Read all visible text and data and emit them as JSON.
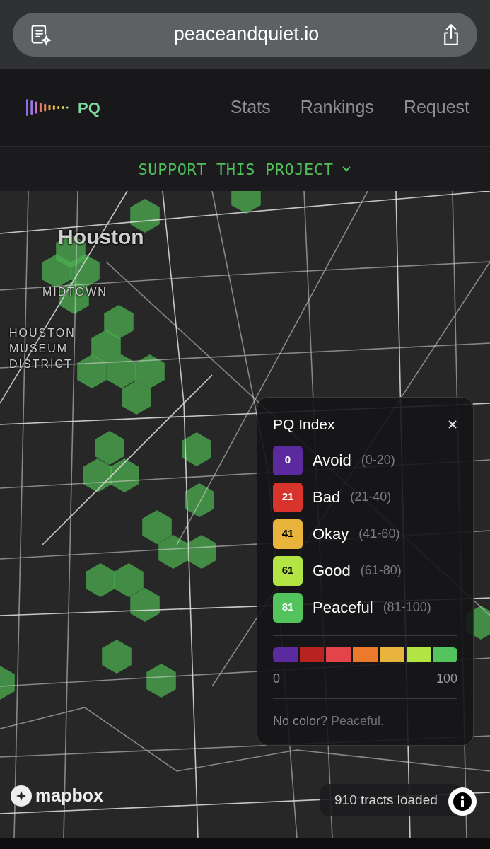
{
  "browser": {
    "url": "peaceandquiet.io"
  },
  "nav": {
    "logo": "PQ",
    "links": [
      {
        "label": "Stats"
      },
      {
        "label": "Rankings"
      },
      {
        "label": "Request"
      }
    ]
  },
  "support": {
    "label": "SUPPORT THIS PROJECT"
  },
  "map": {
    "labels": [
      {
        "text": "Houston",
        "kind": "city"
      },
      {
        "text": "MIDTOWN",
        "kind": "district"
      },
      {
        "text": "HOUSTON MUSEUM DISTRICT",
        "kind": "district"
      }
    ]
  },
  "legend": {
    "title": "PQ Index",
    "items": [
      {
        "value": "0",
        "label": "Avoid",
        "range": "(0-20)",
        "color": "#5b2a9e"
      },
      {
        "value": "21",
        "label": "Bad",
        "range": "(21-40)",
        "color": "#d9342b"
      },
      {
        "value": "41",
        "label": "Okay",
        "range": "(41-60)",
        "color": "#e8b43c"
      },
      {
        "value": "61",
        "label": "Good",
        "range": "(61-80)",
        "color": "#b2e443"
      },
      {
        "value": "81",
        "label": "Peaceful",
        "range": "(81-100)",
        "color": "#52c35d"
      }
    ],
    "scale": {
      "segments": [
        {
          "color": "#5b2a9e"
        },
        {
          "color": "#b8231f"
        },
        {
          "color": "#e2444a"
        },
        {
          "color": "#ec7a2c"
        },
        {
          "color": "#e8b43c"
        },
        {
          "color": "#b2e443"
        },
        {
          "color": "#52c35d"
        }
      ],
      "min": "0",
      "max": "100"
    },
    "note": {
      "question": "No color?",
      "answer": "Peaceful."
    }
  },
  "status": "910 tracts loaded",
  "attribution": "mapbox"
}
